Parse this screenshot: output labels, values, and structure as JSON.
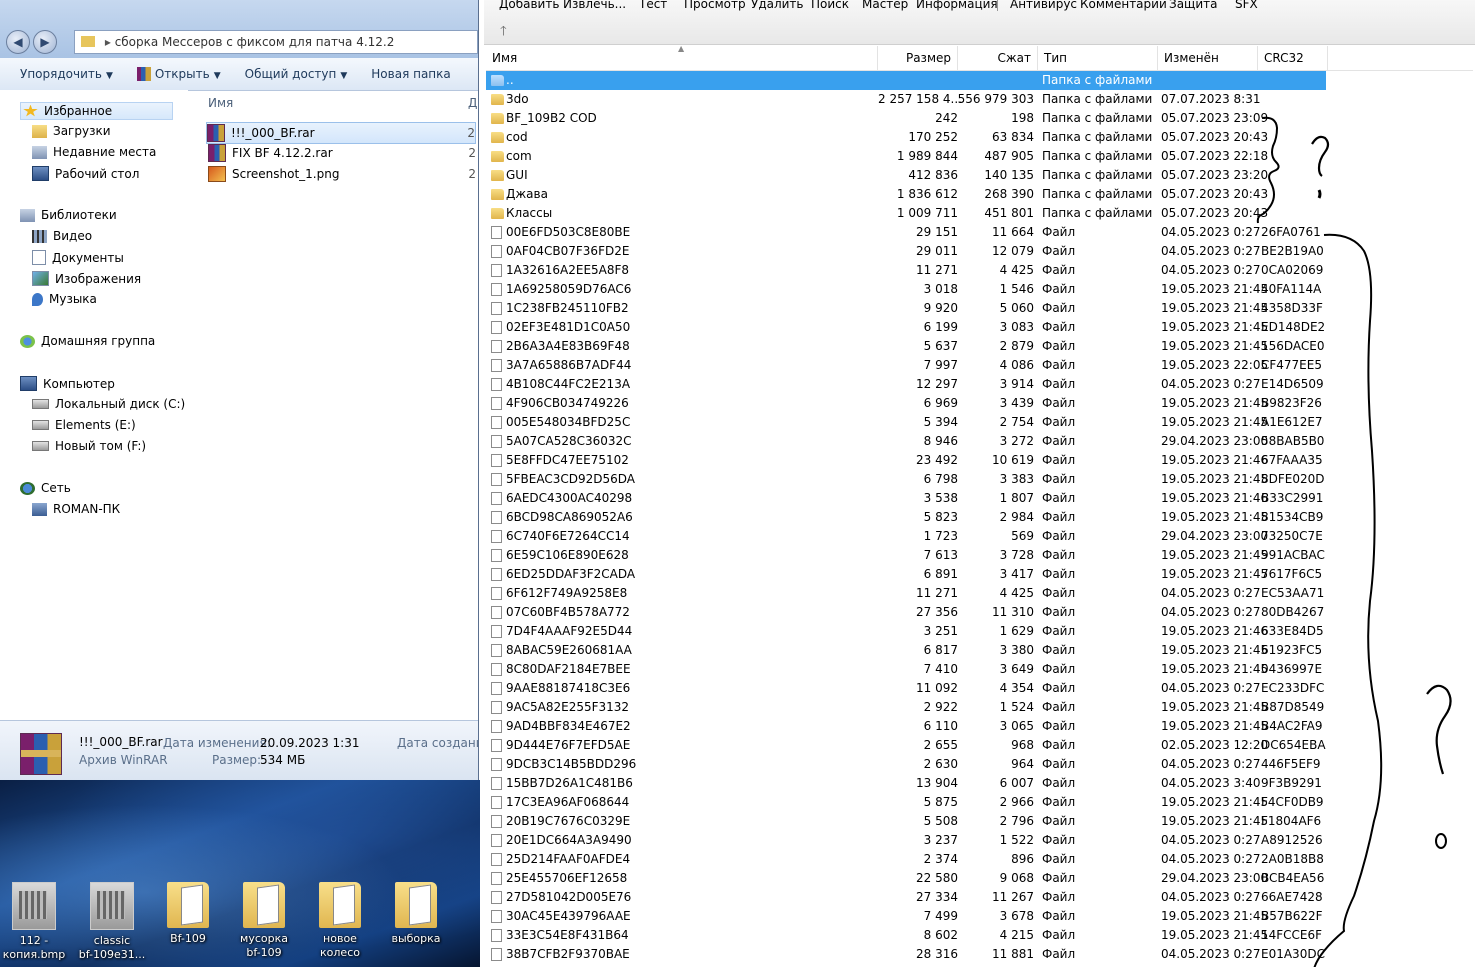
{
  "explorer": {
    "path": "сборка Мессеров с фиксом для патча 4.12.2",
    "toolbar": [
      "Упорядочить",
      "Открыть",
      "Общий доступ",
      "Новая папка"
    ],
    "nav": {
      "favorites": "Избранное",
      "downloads": "Загрузки",
      "recent": "Недавние места",
      "desktop": "Рабочий стол",
      "libraries": "Библиотеки",
      "video": "Видео",
      "documents": "Документы",
      "images": "Изображения",
      "music": "Музыка",
      "homegroup": "Домашняя группа",
      "computer": "Компьютер",
      "disk_c": "Локальный диск (C:)",
      "disk_e": "Elements (E:)",
      "disk_f": "Новый том (F:)",
      "network": "Сеть",
      "pc": "ROMAN-ПК"
    },
    "column_name": "Имя",
    "column_date": "Д",
    "files": [
      {
        "name": "!!!_000_BF.rar",
        "date": "2",
        "icon": "winrar-icon"
      },
      {
        "name": "FIX BF 4.12.2.rar",
        "date": "2",
        "icon": "winrar-icon"
      },
      {
        "name": "Screenshot_1.png",
        "date": "2",
        "icon": "png-icon"
      }
    ],
    "details": {
      "name": "!!!_000_BF.rar",
      "type": "Архив WinRAR",
      "modified_label": "Дата изменения:",
      "modified": "20.09.2023 1:31",
      "size_label": "Размер:",
      "size": "534 МБ",
      "created_label": "Дата создания"
    }
  },
  "desktop_icons": [
    {
      "label1": "112 -",
      "label2": "копия.bmp",
      "kind": "bmp"
    },
    {
      "label1": "classic",
      "label2": "bf-109e31...",
      "kind": "bmp"
    },
    {
      "label1": "Bf-109",
      "label2": "",
      "kind": "folder"
    },
    {
      "label1": "мусорка",
      "label2": "bf-109",
      "kind": "folder"
    },
    {
      "label1": "новое",
      "label2": "колесо",
      "kind": "folder"
    },
    {
      "label1": "выборка",
      "label2": "",
      "kind": "folder"
    }
  ],
  "winrar": {
    "toolbar": [
      "Добавить",
      "Извлечь...",
      "Тест",
      "Просмотр",
      "Удалить",
      "Поиск",
      "Мастер",
      "Информация",
      "Антивирус",
      "Комментарии",
      "Защита",
      "SFX"
    ],
    "columns": {
      "name": "Имя",
      "size": "Размер",
      "packed": "Сжат",
      "type": "Тип",
      "modified": "Изменён",
      "crc": "CRC32"
    },
    "rows": [
      {
        "name": "..",
        "size": "",
        "packed": "",
        "type": "Папка с файлами",
        "modified": "",
        "crc": "",
        "kind": "up"
      },
      {
        "name": "3do",
        "size": "2 257 158 4...",
        "packed": "556 979 303",
        "type": "Папка с файлами",
        "modified": "07.07.2023 8:31",
        "crc": "",
        "kind": "folder"
      },
      {
        "name": "BF_109B2 COD",
        "size": "242",
        "packed": "198",
        "type": "Папка с файлами",
        "modified": "05.07.2023 23:09",
        "crc": "",
        "kind": "folder"
      },
      {
        "name": "cod",
        "size": "170 252",
        "packed": "63 834",
        "type": "Папка с файлами",
        "modified": "05.07.2023 20:43",
        "crc": "",
        "kind": "folder"
      },
      {
        "name": "com",
        "size": "1 989 844",
        "packed": "487 905",
        "type": "Папка с файлами",
        "modified": "05.07.2023 22:18",
        "crc": "",
        "kind": "folder"
      },
      {
        "name": "GUI",
        "size": "412 836",
        "packed": "140 135",
        "type": "Папка с файлами",
        "modified": "05.07.2023 23:20",
        "crc": "",
        "kind": "folder"
      },
      {
        "name": "Джава",
        "size": "1 836 612",
        "packed": "268 390",
        "type": "Папка с файлами",
        "modified": "05.07.2023 20:43",
        "crc": "",
        "kind": "folder"
      },
      {
        "name": "Классы",
        "size": "1 009 711",
        "packed": "451 801",
        "type": "Папка с файлами",
        "modified": "05.07.2023 20:43",
        "crc": "",
        "kind": "folder"
      },
      {
        "name": "00E6FD503C8E80BE",
        "size": "29 151",
        "packed": "11 664",
        "type": "Файл",
        "modified": "04.05.2023 0:27",
        "crc": "26FA0761",
        "kind": "file"
      },
      {
        "name": "0AF04CB07F36FD2E",
        "size": "29 011",
        "packed": "12 079",
        "type": "Файл",
        "modified": "04.05.2023 0:27",
        "crc": "BE2B19A0",
        "kind": "file"
      },
      {
        "name": "1A32616A2EE5A8F8",
        "size": "11 271",
        "packed": "4 425",
        "type": "Файл",
        "modified": "04.05.2023 0:27",
        "crc": "0CA02069",
        "kind": "file"
      },
      {
        "name": "1A69258059D76AC6",
        "size": "3 018",
        "packed": "1 546",
        "type": "Файл",
        "modified": "19.05.2023 21:45",
        "crc": "40FA114A",
        "kind": "file"
      },
      {
        "name": "1C238FB245110FB2",
        "size": "9 920",
        "packed": "5 060",
        "type": "Файл",
        "modified": "19.05.2023 21:45",
        "crc": "4358D33F",
        "kind": "file"
      },
      {
        "name": "02EF3E481D1C0A50",
        "size": "6 199",
        "packed": "3 083",
        "type": "Файл",
        "modified": "19.05.2023 21:45",
        "crc": "ED148DE2",
        "kind": "file"
      },
      {
        "name": "2B6A3A4E83B69F48",
        "size": "5 637",
        "packed": "2 879",
        "type": "Файл",
        "modified": "19.05.2023 21:45",
        "crc": "156DACE0",
        "kind": "file"
      },
      {
        "name": "3A7A65886B7ADF44",
        "size": "7 997",
        "packed": "4 086",
        "type": "Файл",
        "modified": "19.05.2023 22:05",
        "crc": "CF477EE5",
        "kind": "file"
      },
      {
        "name": "4B108C44FC2E213A",
        "size": "12 297",
        "packed": "3 914",
        "type": "Файл",
        "modified": "04.05.2023 0:27",
        "crc": "E14D6509",
        "kind": "file"
      },
      {
        "name": "4F906CB034749226",
        "size": "6 969",
        "packed": "3 439",
        "type": "Файл",
        "modified": "19.05.2023 21:45",
        "crc": "B9823F26",
        "kind": "file"
      },
      {
        "name": "005E548034BFD25C",
        "size": "5 394",
        "packed": "2 754",
        "type": "Файл",
        "modified": "19.05.2023 21:45",
        "crc": "A1E612E7",
        "kind": "file"
      },
      {
        "name": "5A07CA528C36032C",
        "size": "8 946",
        "packed": "3 272",
        "type": "Файл",
        "modified": "29.04.2023 23:00",
        "crc": "58BAB5B0",
        "kind": "file"
      },
      {
        "name": "5E8FFDC47EE75102",
        "size": "23 492",
        "packed": "10 619",
        "type": "Файл",
        "modified": "19.05.2023 21:46",
        "crc": "67FAAA35",
        "kind": "file"
      },
      {
        "name": "5FBEAC3CD92D56DA",
        "size": "6 798",
        "packed": "3 383",
        "type": "Файл",
        "modified": "19.05.2023 21:45",
        "crc": "8DFE020D",
        "kind": "file"
      },
      {
        "name": "6AEDC4300AC40298",
        "size": "3 538",
        "packed": "1 807",
        "type": "Файл",
        "modified": "19.05.2023 21:46",
        "crc": "B33C2991",
        "kind": "file"
      },
      {
        "name": "6BCD98CA869052A6",
        "size": "5 823",
        "packed": "2 984",
        "type": "Файл",
        "modified": "19.05.2023 21:45",
        "crc": "81534CB9",
        "kind": "file"
      },
      {
        "name": "6C740F6E7264CC14",
        "size": "1 723",
        "packed": "569",
        "type": "Файл",
        "modified": "29.04.2023 23:00",
        "crc": "73250C7E",
        "kind": "file"
      },
      {
        "name": "6E59C106E890E628",
        "size": "7 613",
        "packed": "3 728",
        "type": "Файл",
        "modified": "19.05.2023 21:45",
        "crc": "991ACBAC",
        "kind": "file"
      },
      {
        "name": "6ED25DDAF3F2CADA",
        "size": "6 891",
        "packed": "3 417",
        "type": "Файл",
        "modified": "19.05.2023 21:45",
        "crc": "7617F6C5",
        "kind": "file"
      },
      {
        "name": "6F612F749A9258E8",
        "size": "11 271",
        "packed": "4 425",
        "type": "Файл",
        "modified": "04.05.2023 0:27",
        "crc": "EC53AA71",
        "kind": "file"
      },
      {
        "name": "07C60BF4B578A772",
        "size": "27 356",
        "packed": "11 310",
        "type": "Файл",
        "modified": "04.05.2023 0:27",
        "crc": "80DB4267",
        "kind": "file"
      },
      {
        "name": "7D4F4AAAF92E5D44",
        "size": "3 251",
        "packed": "1 629",
        "type": "Файл",
        "modified": "19.05.2023 21:46",
        "crc": "633E84D5",
        "kind": "file"
      },
      {
        "name": "8ABAC59E260681AA",
        "size": "6 817",
        "packed": "3 380",
        "type": "Файл",
        "modified": "19.05.2023 21:45",
        "crc": "61923FC5",
        "kind": "file"
      },
      {
        "name": "8C80DAF2184E7BEE",
        "size": "7 410",
        "packed": "3 649",
        "type": "Файл",
        "modified": "19.05.2023 21:45",
        "crc": "0436997E",
        "kind": "file"
      },
      {
        "name": "9AAE88187418C3E6",
        "size": "11 092",
        "packed": "4 354",
        "type": "Файл",
        "modified": "04.05.2023 0:27",
        "crc": "EC233DFC",
        "kind": "file"
      },
      {
        "name": "9AC5A82E255F3132",
        "size": "2 922",
        "packed": "1 524",
        "type": "Файл",
        "modified": "19.05.2023 21:45",
        "crc": "B87D8549",
        "kind": "file"
      },
      {
        "name": "9AD4BBF834E467E2",
        "size": "6 110",
        "packed": "3 065",
        "type": "Файл",
        "modified": "19.05.2023 21:45",
        "crc": "B4AC2FA9",
        "kind": "file"
      },
      {
        "name": "9D444E76F7EFD5AE",
        "size": "2 655",
        "packed": "968",
        "type": "Файл",
        "modified": "02.05.2023 12:20",
        "crc": "DC654EBA",
        "kind": "file"
      },
      {
        "name": "9DCB3C14B5BDD296",
        "size": "2 630",
        "packed": "964",
        "type": "Файл",
        "modified": "04.05.2023 0:27",
        "crc": "446F5EF9",
        "kind": "file"
      },
      {
        "name": "15BB7D26A1C481B6",
        "size": "13 904",
        "packed": "6 007",
        "type": "Файл",
        "modified": "04.05.2023 3:40",
        "crc": "9F3B9291",
        "kind": "file"
      },
      {
        "name": "17C3EA96AF068644",
        "size": "5 875",
        "packed": "2 966",
        "type": "Файл",
        "modified": "19.05.2023 21:45",
        "crc": "F4CF0DB9",
        "kind": "file"
      },
      {
        "name": "20B19C7676C0329E",
        "size": "5 508",
        "packed": "2 796",
        "type": "Файл",
        "modified": "19.05.2023 21:45",
        "crc": "F1804AF6",
        "kind": "file"
      },
      {
        "name": "20E1DC664A3A9490",
        "size": "3 237",
        "packed": "1 522",
        "type": "Файл",
        "modified": "04.05.2023 0:27",
        "crc": "A8912526",
        "kind": "file"
      },
      {
        "name": "25D214FAAF0AFDE4",
        "size": "2 374",
        "packed": "896",
        "type": "Файл",
        "modified": "04.05.2023 0:27",
        "crc": "2A0B18B8",
        "kind": "file"
      },
      {
        "name": "25E455706EF12658",
        "size": "22 580",
        "packed": "9 068",
        "type": "Файл",
        "modified": "29.04.2023 23:00",
        "crc": "BCB4EA56",
        "kind": "file"
      },
      {
        "name": "27D581042D005E76",
        "size": "27 334",
        "packed": "11 267",
        "type": "Файл",
        "modified": "04.05.2023 0:27",
        "crc": "66AE7428",
        "kind": "file"
      },
      {
        "name": "30AC45E439796AAE",
        "size": "7 499",
        "packed": "3 678",
        "type": "Файл",
        "modified": "19.05.2023 21:45",
        "crc": "B57B622F",
        "kind": "file"
      },
      {
        "name": "33E3C54E8F431B64",
        "size": "8 602",
        "packed": "4 215",
        "type": "Файл",
        "modified": "19.05.2023 21:45",
        "crc": "14FCCE6F",
        "kind": "file"
      },
      {
        "name": "38B7CFB2F9370BAE",
        "size": "28 316",
        "packed": "11 881",
        "type": "Файл",
        "modified": "04.05.2023 0:27",
        "crc": "E01A30DC",
        "kind": "file"
      }
    ]
  },
  "colors": {
    "selection": "#39a0ee",
    "ink": "#000000"
  }
}
